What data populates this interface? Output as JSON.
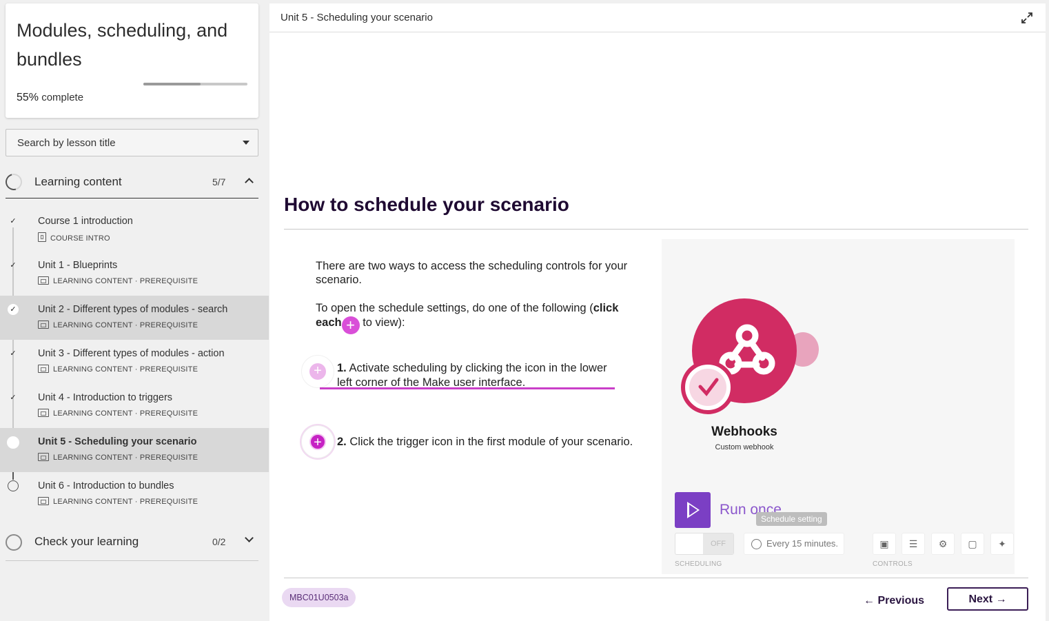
{
  "course": {
    "title": "Modules, scheduling, and bundles",
    "progress_percent": 55,
    "progress_value": "55%",
    "progress_suffix": " complete"
  },
  "search": {
    "placeholder": "Search by lesson title"
  },
  "sections": [
    {
      "title": "Learning content",
      "count": "5/7",
      "lessons": [
        {
          "title": "Course 1 introduction",
          "meta": "COURSE INTRO",
          "status": "done"
        },
        {
          "title": "Unit 1 - Blueprints",
          "meta": "LEARNING CONTENT · PREREQUISITE",
          "status": "done"
        },
        {
          "title": "Unit 2 - Different types of modules - search",
          "meta": "LEARNING CONTENT · PREREQUISITE",
          "status": "done"
        },
        {
          "title": "Unit 3 - Different types of modules - action",
          "meta": "LEARNING CONTENT · PREREQUISITE",
          "status": "done"
        },
        {
          "title": "Unit 4 - Introduction to triggers",
          "meta": "LEARNING CONTENT · PREREQUISITE",
          "status": "done"
        },
        {
          "title": "Unit 5 - Scheduling your scenario",
          "meta": "LEARNING CONTENT · PREREQUISITE",
          "status": "current"
        },
        {
          "title": "Unit 6 - Introduction to bundles",
          "meta": "LEARNING CONTENT · PREREQUISITE",
          "status": "todo"
        }
      ]
    },
    {
      "title": "Check your learning",
      "count": "0/2"
    }
  ],
  "main": {
    "topbar_title": "Unit 5 - Scheduling your scenario",
    "heading": "How to schedule your scenario",
    "intro": "There are two ways to access the scheduling controls for your scenario.",
    "instruction_before": "To open the schedule settings, do one of the following (",
    "instruction_bold": "click each",
    "instruction_after": " to view):",
    "items": [
      {
        "num": "1.",
        "text": " Activate scheduling by clicking the icon in the lower left corner of the Make user interface."
      },
      {
        "num": "2.",
        "text": " Click the trigger icon in the first module of your scenario."
      }
    ],
    "screenshot": {
      "module_title": "Webhooks",
      "module_sub": "Custom webhook",
      "run_label": "Run once",
      "tooltip": "Schedule setting",
      "toggle_off": "OFF",
      "every": "Every 15 minutes.",
      "scheduling_label": "SCHEDULING",
      "controls_label": "CONTROLS"
    }
  },
  "footer": {
    "code": "MBC01U0503a",
    "previous": "← Previous",
    "next": "Next →"
  }
}
